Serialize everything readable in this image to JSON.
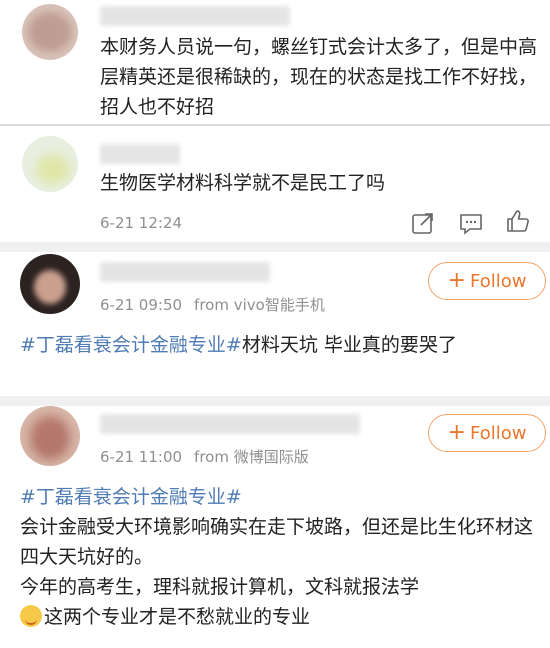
{
  "comments": [
    {
      "text": "本财务人员说一句，螺丝钉式会计太多了，但是中高层精英还是很稀缺的，现在的状态是找工作不好找，招人也不好招"
    },
    {
      "text": "生物医学材料科学就不是民工了吗",
      "time": "6-21 12:24",
      "actions": [
        "share-icon",
        "comment-icon",
        "like-icon"
      ]
    }
  ],
  "posts": [
    {
      "time": "6-21 09:50",
      "source": "from vivo智能手机",
      "follow_label": "Follow",
      "hashtag": "#丁磊看衰会计金融专业#",
      "body": "材料天坑 毕业真的要哭了"
    },
    {
      "time": "6-21 11:00",
      "source": "from 微博国际版",
      "follow_label": "Follow",
      "hashtag": "#丁磊看衰会计金融专业#",
      "lines": [
        "会计金融受大环境影响确实在走下坡路，但还是比生化环材这四大天坑好的。",
        "今年的高考生，理科就报计算机，文科就报法学",
        "这两个专业才是不愁就业的专业"
      ]
    }
  ],
  "colors": {
    "accent": "#e9772a",
    "link": "#4f7cb4",
    "meta": "#8f8f8f"
  }
}
